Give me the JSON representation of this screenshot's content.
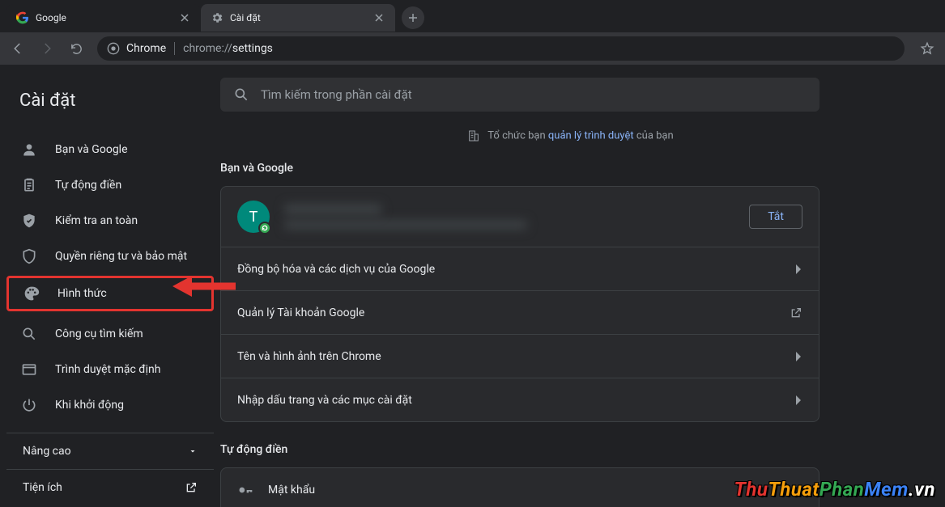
{
  "tabs": {
    "inactive": {
      "title": "Google"
    },
    "active": {
      "title": "Cài đặt"
    }
  },
  "toolbar": {
    "omnibox_scheme": "Chrome",
    "omnibox_host": "chrome://",
    "omnibox_path": "settings"
  },
  "sidebar": {
    "title": "Cài đặt",
    "items": [
      {
        "label": "Bạn và Google"
      },
      {
        "label": "Tự động điền"
      },
      {
        "label": "Kiểm tra an toàn"
      },
      {
        "label": "Quyền riêng tư và bảo mật"
      },
      {
        "label": "Hình thức"
      },
      {
        "label": "Công cụ tìm kiếm"
      },
      {
        "label": "Trình duyệt mặc định"
      },
      {
        "label": "Khi khởi động"
      }
    ],
    "advanced": "Nâng cao",
    "extensions": "Tiện ích"
  },
  "search": {
    "placeholder": "Tìm kiếm trong phần cài đặt"
  },
  "managed_banner": {
    "prefix": "Tổ chức bạn ",
    "link": "quản lý trình duyệt",
    "suffix": " của bạn"
  },
  "sections": {
    "you_and_google": {
      "title": "Bạn và Google",
      "profile_initial": "T",
      "turn_off": "Tắt",
      "rows": [
        "Đồng bộ hóa và các dịch vụ của Google",
        "Quản lý Tài khoản Google",
        "Tên và hình ảnh trên Chrome",
        "Nhập dấu trang và các mục cài đặt"
      ]
    },
    "autofill": {
      "title": "Tự động điền",
      "rows": [
        "Mật khẩu"
      ]
    }
  },
  "watermark": "ThuThuatPhanMem.vn"
}
